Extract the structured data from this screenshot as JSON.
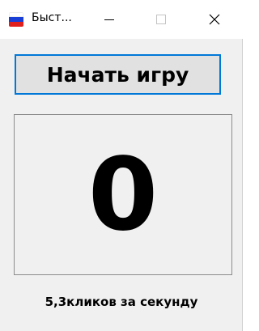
{
  "window": {
    "title": "Быст...",
    "icon": "russian-flag-icon",
    "controls": {
      "minimize_icon": "minimize-icon",
      "maximize_icon": "maximize-icon",
      "close_icon": "close-icon"
    }
  },
  "main": {
    "start_button_label": "Начать игру",
    "score": "0",
    "status_text": "5,3кликов за секунду"
  },
  "colors": {
    "focus_border": "#0078d7",
    "window_bg": "#f0f0f0",
    "button_bg": "#e1e1e1"
  }
}
